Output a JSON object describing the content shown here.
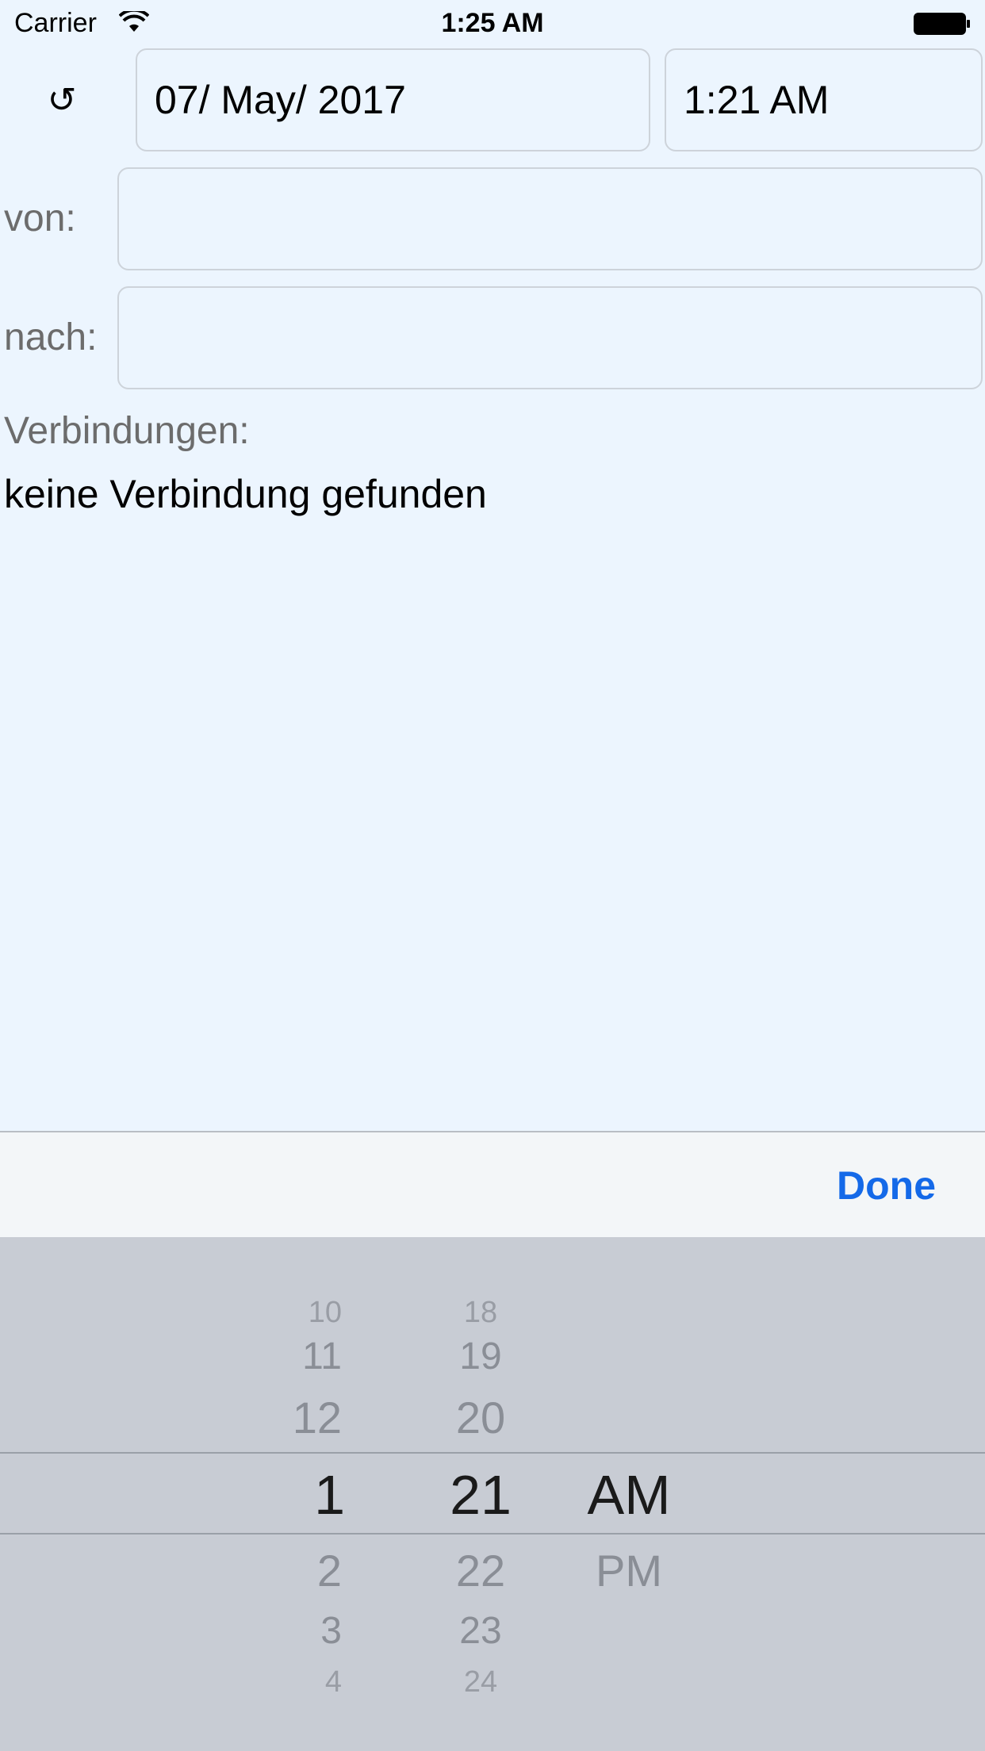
{
  "status_bar": {
    "carrier": "Carrier",
    "time": "1:25 AM"
  },
  "header": {
    "reset_icon": "↺",
    "date_value": "07/ May/ 2017",
    "time_value": "1:21 AM"
  },
  "form": {
    "from_label": "von:",
    "from_value": "",
    "to_label": "nach:",
    "to_value": ""
  },
  "connections": {
    "label": "Verbindungen:",
    "result": "keine Verbindung gefunden"
  },
  "toolbar": {
    "done_label": "Done"
  },
  "picker": {
    "hours": [
      "10",
      "11",
      "12",
      "1",
      "2",
      "3",
      "4"
    ],
    "selected_hour": "1",
    "minutes": [
      "18",
      "19",
      "20",
      "21",
      "22",
      "23",
      "24"
    ],
    "selected_minute": "21",
    "periods": [
      "AM",
      "PM"
    ],
    "selected_period": "AM"
  },
  "colors": {
    "background": "#ecf5fe",
    "accent": "#1469e8",
    "picker_background": "#c8ccd4"
  }
}
